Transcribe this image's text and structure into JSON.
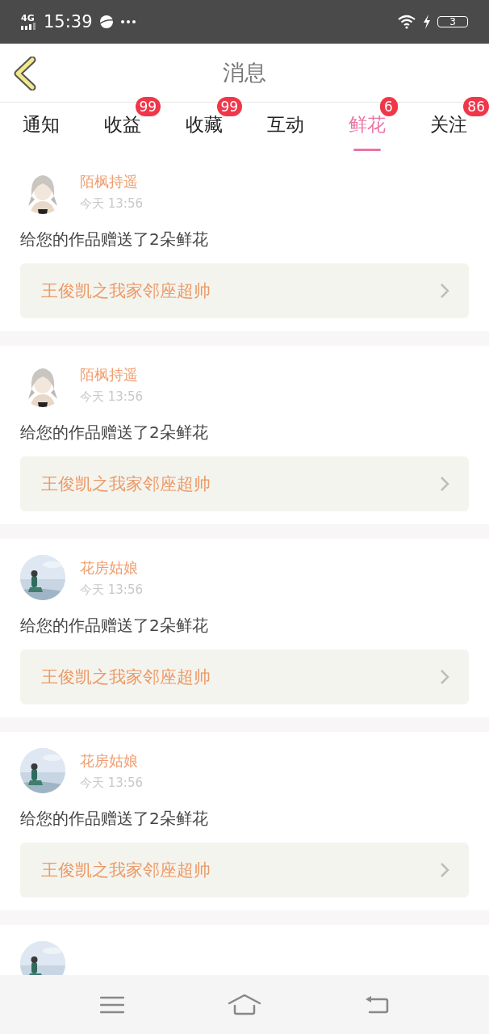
{
  "status_bar": {
    "network": "4G",
    "time": "15:39",
    "battery": "3"
  },
  "header": {
    "title": "消息"
  },
  "tabs": [
    {
      "label": "通知",
      "selected": false
    },
    {
      "label": "收益",
      "selected": false,
      "badge": "99"
    },
    {
      "label": "收藏",
      "selected": false,
      "badge": "99"
    },
    {
      "label": "互动",
      "selected": false
    },
    {
      "label": "鲜花",
      "selected": true,
      "badge": "6"
    },
    {
      "label": "关注",
      "selected": false,
      "badge": "86"
    }
  ],
  "messages": [
    {
      "kind": "full",
      "name": "陌枫持遥",
      "time": "今天 13:56",
      "text": "给您的作品赠送了2朵鲜花",
      "work": "王俊凯之我家邻座超帅"
    },
    {
      "kind": "full",
      "name": "陌枫持遥",
      "time": "今天 13:56",
      "text": "给您的作品赠送了2朵鲜花",
      "work": "王俊凯之我家邻座超帅"
    },
    {
      "kind": "full",
      "name": "花房姑娘",
      "time": "今天 13:56",
      "text": "给您的作品赠送了2朵鲜花",
      "work": "王俊凯之我家邻座超帅"
    },
    {
      "kind": "full",
      "name": "花房姑娘",
      "time": "今天 13:56",
      "text": "给您的作品赠送了2朵鲜花",
      "work": "王俊凯之我家邻座超帅"
    },
    {
      "kind": "partial"
    }
  ]
}
